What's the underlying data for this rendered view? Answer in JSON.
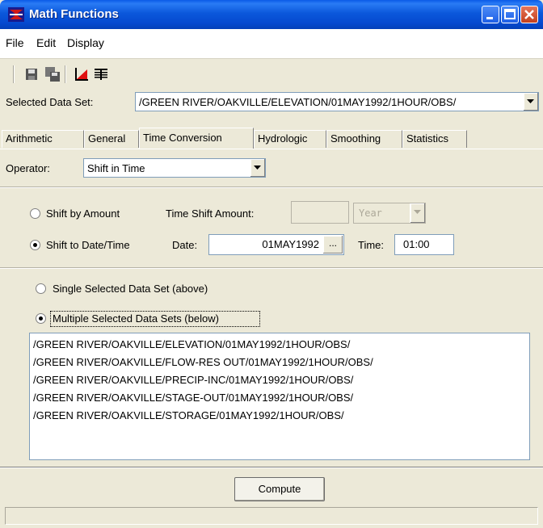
{
  "window": {
    "title": "Math Functions",
    "title_bar_color": "#0a5ae8",
    "buttons": {
      "minimize": "minimize-icon",
      "maximize": "maximize-icon",
      "close": "close-icon"
    }
  },
  "menu": {
    "items": [
      "File",
      "Edit",
      "Display"
    ]
  },
  "toolbar": {
    "icons": [
      "save-icon",
      "save-as-icon",
      "plot-icon",
      "tabulate-icon"
    ]
  },
  "selected_data_set": {
    "label": "Selected Data Set:",
    "value": "/GREEN RIVER/OAKVILLE/ELEVATION/01MAY1992/1HOUR/OBS/"
  },
  "tabs": [
    {
      "label": "Arithmetic"
    },
    {
      "label": "General"
    },
    {
      "label": "Time Conversion"
    },
    {
      "label": "Hydrologic"
    },
    {
      "label": "Smoothing"
    },
    {
      "label": "Statistics"
    }
  ],
  "active_tab": "Time Conversion",
  "operator": {
    "label": "Operator:",
    "value": "Shift in Time"
  },
  "shift_by_amount": {
    "label": "Shift by Amount",
    "checked": false,
    "amount_label": "Time Shift Amount:",
    "amount_value": "",
    "unit_value": "Year"
  },
  "shift_to_date": {
    "label": "Shift to Date/Time",
    "checked": true,
    "date_label": "Date:",
    "date_value": "01MAY1992",
    "date_button": "...",
    "time_label": "Time:",
    "time_value": "01:00"
  },
  "scope": {
    "single_label": "Single Selected Data Set (above)",
    "single_checked": false,
    "multiple_label": "Multiple Selected Data Sets (below)",
    "multiple_checked": true
  },
  "data_sets": [
    "/GREEN RIVER/OAKVILLE/ELEVATION/01MAY1992/1HOUR/OBS/",
    "/GREEN RIVER/OAKVILLE/FLOW-RES OUT/01MAY1992/1HOUR/OBS/",
    "/GREEN RIVER/OAKVILLE/PRECIP-INC/01MAY1992/1HOUR/OBS/",
    "/GREEN RIVER/OAKVILLE/STAGE-OUT/01MAY1992/1HOUR/OBS/",
    "/GREEN RIVER/OAKVILLE/STORAGE/01MAY1992/1HOUR/OBS/"
  ],
  "compute_button": "Compute",
  "status": ""
}
